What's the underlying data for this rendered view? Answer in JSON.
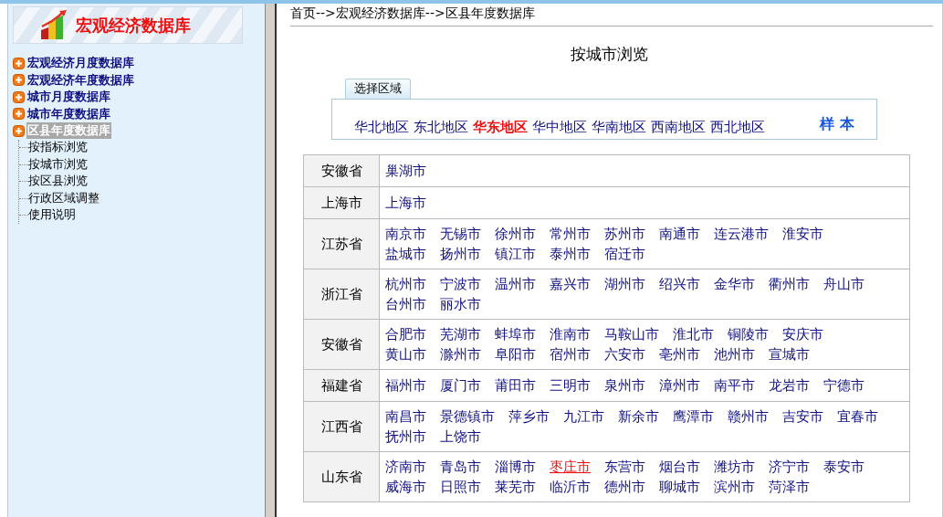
{
  "logo": {
    "title": "宏观经济数据库"
  },
  "sidebar": {
    "items": [
      {
        "label": "宏观经济月度数据库",
        "selected": false
      },
      {
        "label": "宏观经济年度数据库",
        "selected": false
      },
      {
        "label": "城市月度数据库",
        "selected": false
      },
      {
        "label": "城市年度数据库",
        "selected": false
      },
      {
        "label": "区县年度数据库",
        "selected": true,
        "children": [
          {
            "label": "按指标浏览"
          },
          {
            "label": "按城市浏览"
          },
          {
            "label": "按区县浏览"
          },
          {
            "label": "行政区域调整"
          },
          {
            "label": "使用说明"
          }
        ]
      }
    ]
  },
  "breadcrumb": "首页-->宏观经济数据库-->区县年度数据库",
  "page_title": "按城市浏览",
  "region_panel": {
    "tab": "选择区域",
    "regions": [
      {
        "label": "华北地区",
        "selected": false
      },
      {
        "label": "东北地区",
        "selected": false
      },
      {
        "label": "华东地区",
        "selected": true
      },
      {
        "label": "华中地区",
        "selected": false
      },
      {
        "label": "华南地区",
        "selected": false
      },
      {
        "label": "西南地区",
        "selected": false
      },
      {
        "label": "西北地区",
        "selected": false
      }
    ],
    "sample_link": "样 本"
  },
  "table": {
    "rows": [
      {
        "province": "安徽省",
        "lines": [
          [
            {
              "name": "巢湖市",
              "selected": false
            }
          ]
        ]
      },
      {
        "province": "上海市",
        "lines": [
          [
            {
              "name": "上海市",
              "selected": false
            }
          ]
        ]
      },
      {
        "province": "江苏省",
        "lines": [
          [
            {
              "name": "南京市",
              "selected": false
            },
            {
              "name": "无锡市",
              "selected": false
            },
            {
              "name": "徐州市",
              "selected": false
            },
            {
              "name": "常州市",
              "selected": false
            },
            {
              "name": "苏州市",
              "selected": false
            },
            {
              "name": "南通市",
              "selected": false
            },
            {
              "name": "连云港市",
              "selected": false
            },
            {
              "name": "淮安市",
              "selected": false
            }
          ],
          [
            {
              "name": "盐城市",
              "selected": false
            },
            {
              "name": "扬州市",
              "selected": false
            },
            {
              "name": "镇江市",
              "selected": false
            },
            {
              "name": "泰州市",
              "selected": false
            },
            {
              "name": "宿迁市",
              "selected": false
            }
          ]
        ]
      },
      {
        "province": "浙江省",
        "lines": [
          [
            {
              "name": "杭州市",
              "selected": false
            },
            {
              "name": "宁波市",
              "selected": false
            },
            {
              "name": "温州市",
              "selected": false
            },
            {
              "name": "嘉兴市",
              "selected": false
            },
            {
              "name": "湖州市",
              "selected": false
            },
            {
              "name": "绍兴市",
              "selected": false
            },
            {
              "name": "金华市",
              "selected": false
            },
            {
              "name": "衢州市",
              "selected": false
            },
            {
              "name": "舟山市",
              "selected": false
            }
          ],
          [
            {
              "name": "台州市",
              "selected": false
            },
            {
              "name": "丽水市",
              "selected": false
            }
          ]
        ]
      },
      {
        "province": "安徽省",
        "lines": [
          [
            {
              "name": "合肥市",
              "selected": false
            },
            {
              "name": "芜湖市",
              "selected": false
            },
            {
              "name": "蚌埠市",
              "selected": false
            },
            {
              "name": "淮南市",
              "selected": false
            },
            {
              "name": "马鞍山市",
              "selected": false
            },
            {
              "name": "淮北市",
              "selected": false
            },
            {
              "name": "铜陵市",
              "selected": false
            },
            {
              "name": "安庆市",
              "selected": false
            }
          ],
          [
            {
              "name": "黄山市",
              "selected": false
            },
            {
              "name": "滁州市",
              "selected": false
            },
            {
              "name": "阜阳市",
              "selected": false
            },
            {
              "name": "宿州市",
              "selected": false
            },
            {
              "name": "六安市",
              "selected": false
            },
            {
              "name": "亳州市",
              "selected": false
            },
            {
              "name": "池州市",
              "selected": false
            },
            {
              "name": "宣城市",
              "selected": false
            }
          ]
        ]
      },
      {
        "province": "福建省",
        "lines": [
          [
            {
              "name": "福州市",
              "selected": false
            },
            {
              "name": "厦门市",
              "selected": false
            },
            {
              "name": "莆田市",
              "selected": false
            },
            {
              "name": "三明市",
              "selected": false
            },
            {
              "name": "泉州市",
              "selected": false
            },
            {
              "name": "漳州市",
              "selected": false
            },
            {
              "name": "南平市",
              "selected": false
            },
            {
              "name": "龙岩市",
              "selected": false
            },
            {
              "name": "宁德市",
              "selected": false
            }
          ]
        ]
      },
      {
        "province": "江西省",
        "lines": [
          [
            {
              "name": "南昌市",
              "selected": false
            },
            {
              "name": "景德镇市",
              "selected": false
            },
            {
              "name": "萍乡市",
              "selected": false
            },
            {
              "name": "九江市",
              "selected": false
            },
            {
              "name": "新余市",
              "selected": false
            },
            {
              "name": "鹰潭市",
              "selected": false
            },
            {
              "name": "赣州市",
              "selected": false
            },
            {
              "name": "吉安市",
              "selected": false
            },
            {
              "name": "宜春市",
              "selected": false
            }
          ],
          [
            {
              "name": "抚州市",
              "selected": false
            },
            {
              "name": "上饶市",
              "selected": false
            }
          ]
        ]
      },
      {
        "province": "山东省",
        "lines": [
          [
            {
              "name": "济南市",
              "selected": false
            },
            {
              "name": "青岛市",
              "selected": false
            },
            {
              "name": "淄博市",
              "selected": false
            },
            {
              "name": "枣庄市",
              "selected": true
            },
            {
              "name": "东营市",
              "selected": false
            },
            {
              "name": "烟台市",
              "selected": false
            },
            {
              "name": "潍坊市",
              "selected": false
            },
            {
              "name": "济宁市",
              "selected": false
            },
            {
              "name": "泰安市",
              "selected": false
            }
          ],
          [
            {
              "name": "威海市",
              "selected": false
            },
            {
              "name": "日照市",
              "selected": false
            },
            {
              "name": "莱芜市",
              "selected": false
            },
            {
              "name": "临沂市",
              "selected": false
            },
            {
              "name": "德州市",
              "selected": false
            },
            {
              "name": "聊城市",
              "selected": false
            },
            {
              "name": "滨州市",
              "selected": false
            },
            {
              "name": "菏泽市",
              "selected": false
            }
          ]
        ]
      }
    ]
  }
}
